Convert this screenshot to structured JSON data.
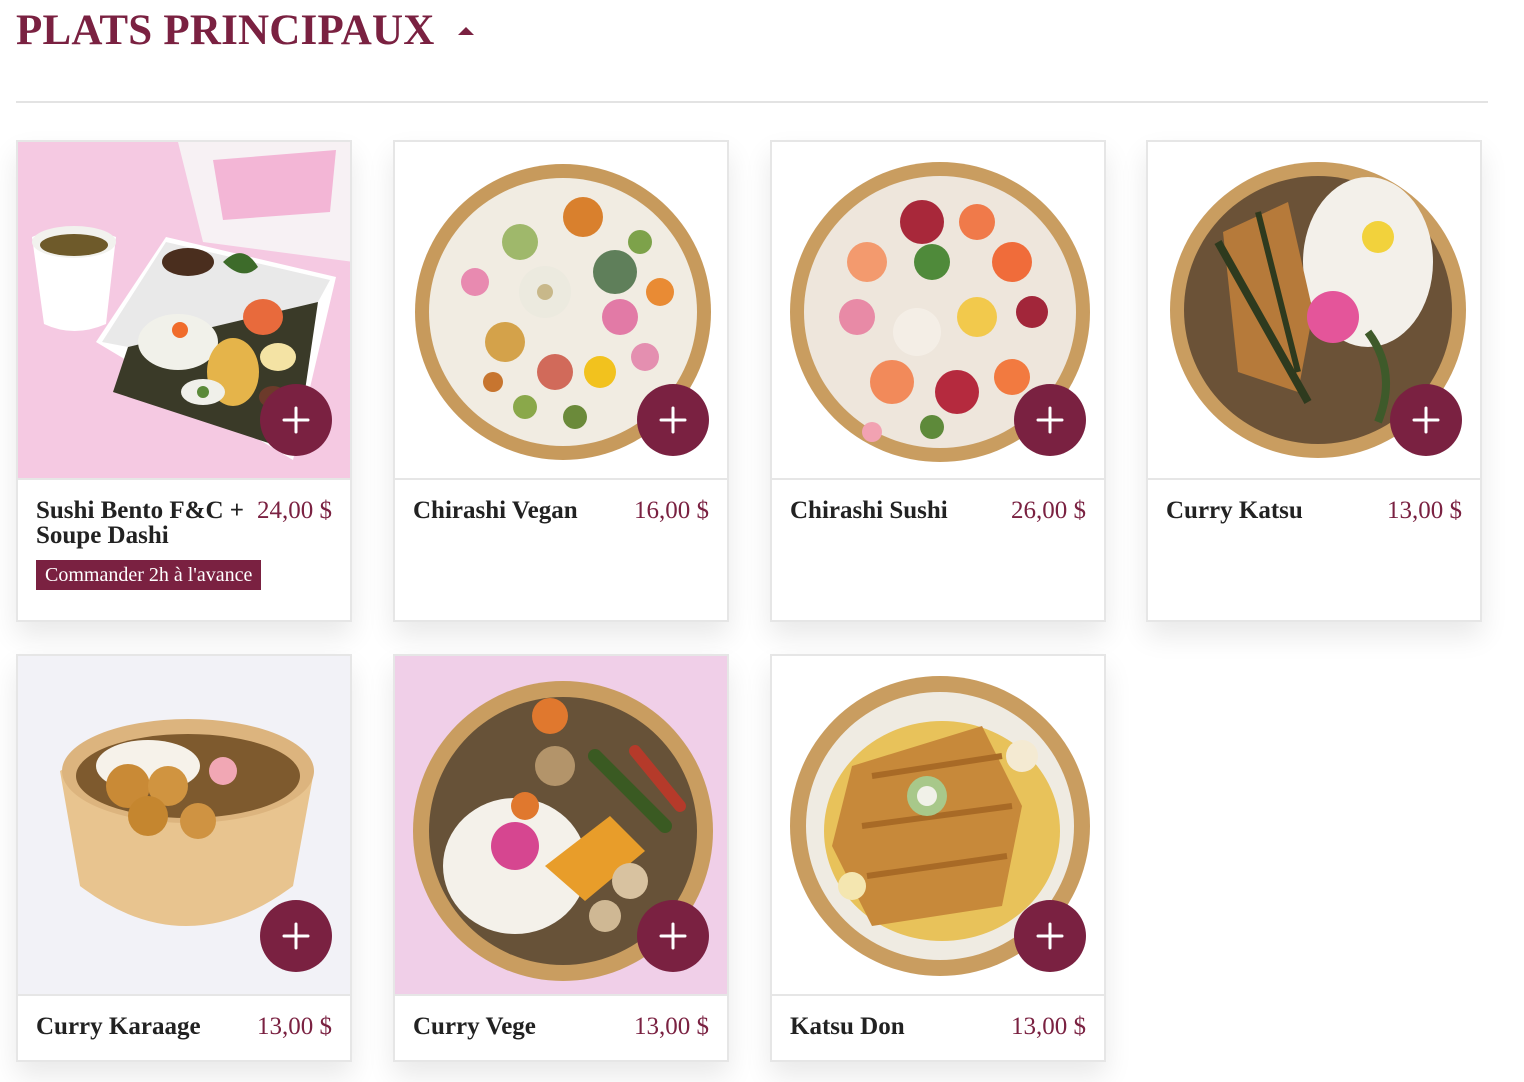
{
  "section": {
    "title": "PLATS PRINCIPAUX",
    "toggle_icon": "caret-up-icon"
  },
  "colors": {
    "accent": "#7a2141",
    "text": "#222222",
    "divider": "#e3e3e3"
  },
  "add_icon": "plus-icon",
  "items": [
    {
      "name": "Sushi Bento F&C + Soupe Dashi",
      "price": "24,00 $",
      "badge": "Commander 2h à l'avance"
    },
    {
      "name": "Chirashi Vegan",
      "price": "16,00 $"
    },
    {
      "name": "Chirashi Sushi",
      "price": "26,00 $"
    },
    {
      "name": "Curry Katsu",
      "price": "13,00 $"
    },
    {
      "name": "Curry Karaage",
      "price": "13,00 $"
    },
    {
      "name": "Curry Vege",
      "price": "13,00 $"
    },
    {
      "name": "Katsu Don",
      "price": "13,00 $"
    }
  ]
}
